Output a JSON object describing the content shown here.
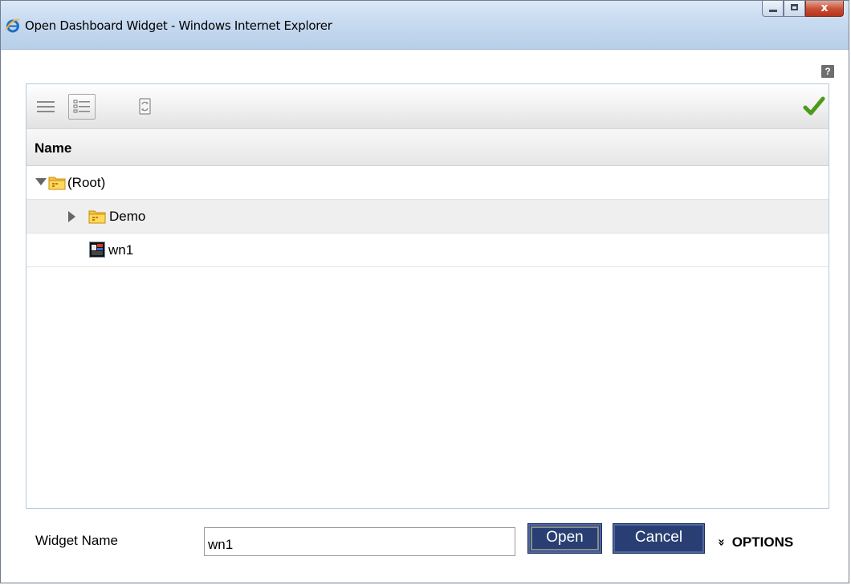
{
  "window": {
    "title": "Open Dashboard Widget - Windows Internet Explorer",
    "close_glyph": "x"
  },
  "help": {
    "label": "?"
  },
  "toolbar": {
    "icons": [
      "list-view-icon",
      "detail-view-icon",
      "refresh-icon",
      "confirm-check-icon"
    ],
    "accent_check_color": "#4c9a1a"
  },
  "table": {
    "column_header": "Name",
    "rows": [
      {
        "label": "(Root)",
        "type": "folder",
        "expanded": true
      },
      {
        "label": "Demo",
        "type": "folder",
        "expanded": false
      },
      {
        "label": "wn1",
        "type": "widget"
      }
    ]
  },
  "footer": {
    "widget_name_label": "Widget Name",
    "widget_name_value": "wn1",
    "open_label": "Open",
    "cancel_label": "Cancel",
    "options_glyph": "»",
    "options_label": "OPTIONS"
  },
  "colors": {
    "button_bg": "#293f73",
    "titlebar": "#c7daf0",
    "folder": "#f2c53d"
  }
}
